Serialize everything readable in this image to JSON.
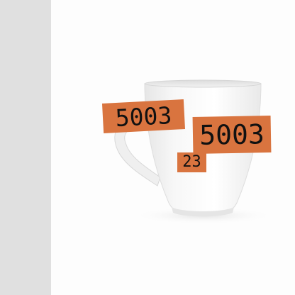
{
  "scene": {
    "subject": "white-mug",
    "background_color": "#fdfdfd",
    "side_panel_color": "#e0e0e0",
    "tag_color": "#d9743f"
  },
  "labels": [
    {
      "text": "5003"
    },
    {
      "text": "5003"
    },
    {
      "text": "23"
    }
  ]
}
